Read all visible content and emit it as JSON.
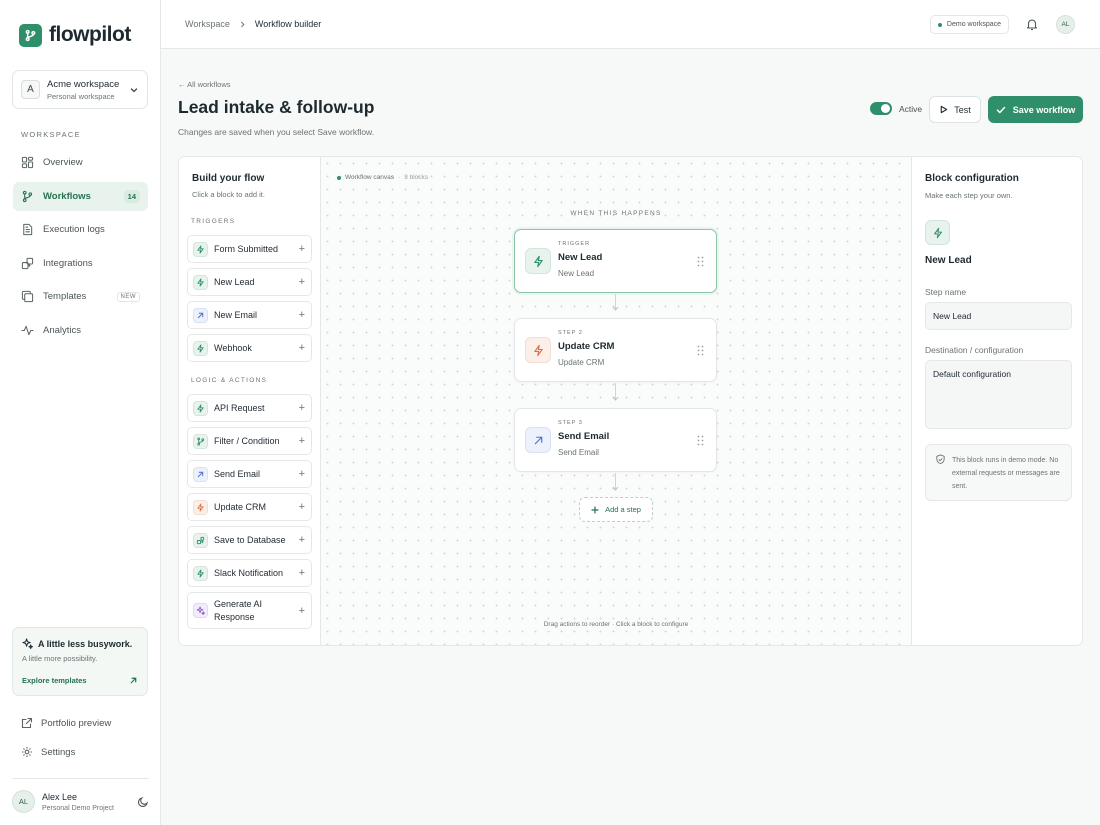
{
  "brand": {
    "name": "flowpilot"
  },
  "workspace": {
    "initial": "A",
    "name": "Acme workspace",
    "sub": "Personal workspace"
  },
  "sidebar": {
    "section_label": "WORKSPACE",
    "items": [
      {
        "label": "Overview",
        "icon": "grid-icon"
      },
      {
        "label": "Workflows",
        "icon": "branch-icon",
        "count": "14"
      },
      {
        "label": "Execution logs",
        "icon": "document-icon"
      },
      {
        "label": "Integrations",
        "icon": "puzzle-icon"
      },
      {
        "label": "Templates",
        "icon": "copy-icon",
        "badge": "NEW"
      },
      {
        "label": "Analytics",
        "icon": "pulse-icon"
      }
    ],
    "promo": {
      "title": "A little less busywork.",
      "sub": "A little more possibility.",
      "link": "Explore templates"
    },
    "portfolio": "Portfolio preview",
    "settings": "Settings",
    "user": {
      "initials": "AL",
      "name": "Alex Lee",
      "sub": "Personal Demo Project"
    }
  },
  "topbar": {
    "crumbs": [
      "Workspace",
      "Workflow builder"
    ],
    "demo": "Demo workspace",
    "avatar": "AL"
  },
  "header": {
    "back": "← All workflows",
    "title": "Lead intake & follow-up",
    "sub": "Changes are saved when you select Save workflow.",
    "toggle_label": "Active",
    "test_label": "Test",
    "save_label": "Save workflow"
  },
  "palette": {
    "title": "Build your flow",
    "sub": "Click a block to add it.",
    "triggers_label": "TRIGGERS",
    "triggers": [
      {
        "label": "Form Submitted",
        "color": "green"
      },
      {
        "label": "New Lead",
        "color": "green"
      },
      {
        "label": "New Email",
        "color": "blue"
      },
      {
        "label": "Webhook",
        "color": "green"
      }
    ],
    "actions_label": "LOGIC & ACTIONS",
    "actions": [
      {
        "label": "API Request",
        "color": "green"
      },
      {
        "label": "Filter / Condition",
        "color": "green"
      },
      {
        "label": "Send Email",
        "color": "blue"
      },
      {
        "label": "Update CRM",
        "color": "orange"
      },
      {
        "label": "Save to Database",
        "color": "green"
      },
      {
        "label": "Slack Notification",
        "color": "green"
      },
      {
        "label": "Generate AI Response",
        "color": "purple"
      }
    ]
  },
  "canvas": {
    "tag": "Workflow canvas",
    "count": "3 blocks",
    "when": "WHEN THIS HAPPENS",
    "steps": [
      {
        "kicker": "TRIGGER",
        "title": "New Lead",
        "sub": "New Lead",
        "color": "green"
      },
      {
        "kicker": "STEP 2",
        "title": "Update CRM",
        "sub": "Update CRM",
        "color": "orange"
      },
      {
        "kicker": "STEP 3",
        "title": "Send Email",
        "sub": "Send Email",
        "color": "blue"
      }
    ],
    "add_step": "Add a step",
    "footer": "Drag actions to reorder · Click a block to configure"
  },
  "config": {
    "title": "Block configuration",
    "sub": "Make each step your own.",
    "block_name": "New Lead",
    "step_name_label": "Step name",
    "step_name_value": "New Lead",
    "dest_label": "Destination / configuration",
    "dest_value": "Default configuration",
    "note": "This block runs in demo mode. No external requests or messages are sent."
  },
  "colors": {
    "accent": "#2f8f6a",
    "blue": "#4a72c9",
    "orange": "#d9734a",
    "purple": "#8a5cc7"
  }
}
